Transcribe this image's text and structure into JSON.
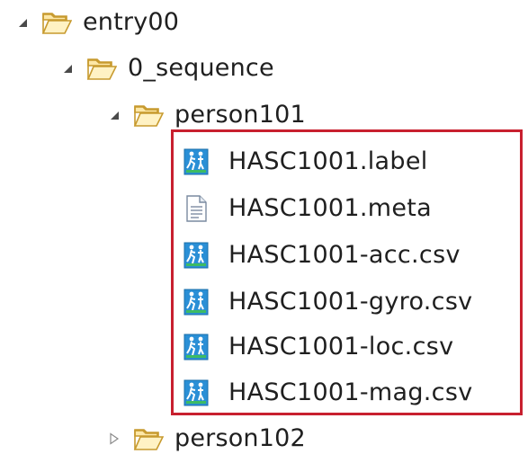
{
  "tree": {
    "entry": {
      "label": "entry00",
      "icon": "folder-open-icon",
      "expanded": true
    },
    "sequence": {
      "label": "0_sequence",
      "icon": "folder-open-icon",
      "expanded": true
    },
    "person101": {
      "label": "person101",
      "icon": "folder-open-icon",
      "expanded": true
    },
    "files": [
      {
        "label": "HASC1001.label",
        "icon": "activity-file-icon"
      },
      {
        "label": "HASC1001.meta",
        "icon": "text-document-icon"
      },
      {
        "label": "HASC1001-acc.csv",
        "icon": "activity-file-icon"
      },
      {
        "label": "HASC1001-gyro.csv",
        "icon": "activity-file-icon"
      },
      {
        "label": "HASC1001-loc.csv",
        "icon": "activity-file-icon"
      },
      {
        "label": "HASC1001-mag.csv",
        "icon": "activity-file-icon"
      }
    ],
    "person102": {
      "label": "person102",
      "icon": "folder-open-icon",
      "expanded": false
    }
  },
  "colors": {
    "highlight": "#c8202f",
    "folder_fill": "#fde7a6",
    "folder_stroke": "#c79a2e",
    "activity_bg": "#2a8fd6",
    "activity_green": "#3dbb63"
  }
}
